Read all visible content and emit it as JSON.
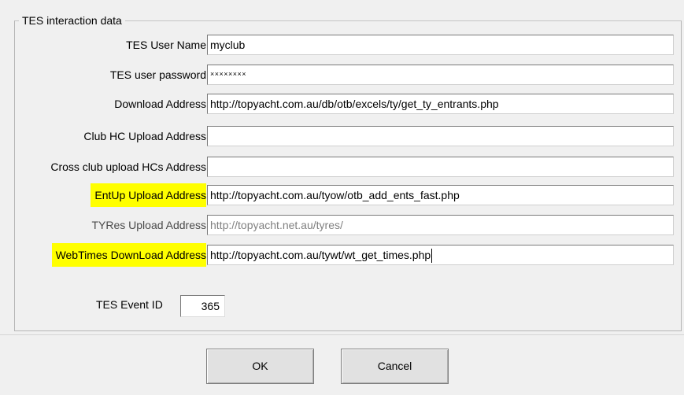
{
  "group": {
    "title": "TES interaction data"
  },
  "fields": [
    {
      "label": "TES User Name",
      "value": "myclub"
    },
    {
      "label": "TES user password",
      "value": "××××××××"
    },
    {
      "label": "Download Address",
      "value": "http://topyacht.com.au/db/otb/excels/ty/get_ty_entrants.php"
    },
    {
      "label": "Club HC Upload Address",
      "value": ""
    },
    {
      "label": "Cross club upload HCs Address",
      "value": ""
    },
    {
      "label": "EntUp Upload Address",
      "value": "http://topyacht.com.au/tyow/otb_add_ents_fast.php"
    },
    {
      "label": "TYRes Upload Address",
      "value": "http://topyacht.net.au/tyres/"
    },
    {
      "label": "WebTimes DownLoad Address",
      "value": "http://topyacht.com.au/tywt/wt_get_times.php"
    }
  ],
  "event": {
    "label": "TES Event ID",
    "value": "365"
  },
  "buttons": {
    "ok": "OK",
    "cancel": "Cancel"
  },
  "colors": {
    "highlight": "#ffff00",
    "disabled_text": "#808080"
  }
}
